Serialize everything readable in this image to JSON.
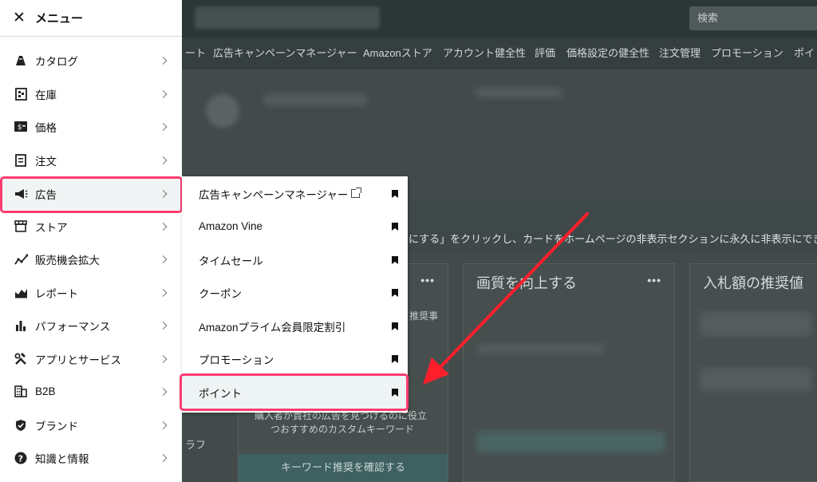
{
  "topbar": {
    "search_placeholder": "検索"
  },
  "nav": [
    "ート",
    "広告キャンペーンマネージャー",
    "Amazonストア",
    "アカウント健全性",
    "評価",
    "価格設定の健全性",
    "注文管理",
    "プロモーション",
    "ポイ"
  ],
  "notice_text": "にする」をクリックし、カードをホームページの非表示セクションに永久に非表示にでき",
  "cards": [
    {
      "title": "",
      "text1": "推奨事",
      "text2": "購入者が貴社の広告を見つけるのに役立",
      "text3": "つおすすめのカスタムキーワード",
      "button": "キーワード推奨を確認する",
      "side": "ラフ"
    },
    {
      "title": "画質を向上する"
    },
    {
      "title": "入札額の推奨値"
    }
  ],
  "menu": {
    "title": "メニュー",
    "items": [
      {
        "label": "カタログ",
        "icon": "catalog-icon"
      },
      {
        "label": "在庫",
        "icon": "inventory-icon"
      },
      {
        "label": "価格",
        "icon": "pricing-icon"
      },
      {
        "label": "注文",
        "icon": "orders-icon"
      },
      {
        "label": "広告",
        "icon": "megaphone-icon"
      },
      {
        "label": "ストア",
        "icon": "store-icon"
      },
      {
        "label": "販売機会拡大",
        "icon": "growth-icon"
      },
      {
        "label": "レポート",
        "icon": "reports-icon"
      },
      {
        "label": "パフォーマンス",
        "icon": "performance-icon"
      },
      {
        "label": "アプリとサービス",
        "icon": "tools-icon"
      },
      {
        "label": "B2B",
        "icon": "b2b-icon"
      },
      {
        "label": "ブランド",
        "icon": "brand-shield-icon"
      },
      {
        "label": "知識と情報",
        "icon": "help-icon"
      }
    ]
  },
  "submenu": {
    "items": [
      {
        "label": "広告キャンペーンマネージャー"
      },
      {
        "label": "Amazon Vine"
      },
      {
        "label": "タイムセール"
      },
      {
        "label": "クーポン"
      },
      {
        "label": "Amazonプライム会員限定割引"
      },
      {
        "label": "プロモーション"
      },
      {
        "label": "ポイント"
      }
    ]
  },
  "colors": {
    "highlight": "#ff3d70",
    "arrow": "#ff1f2c"
  }
}
